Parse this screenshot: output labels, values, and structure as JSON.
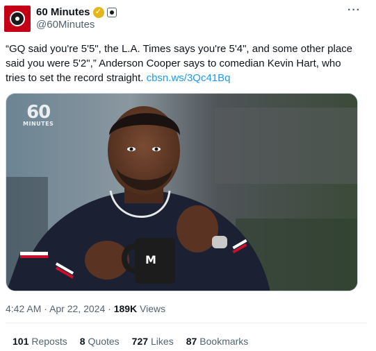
{
  "author": {
    "display_name": "60 Minutes",
    "handle": "@60Minutes",
    "verified_badge": "✓"
  },
  "tweet": {
    "text": "“GQ said you're 5'5\", the L.A. Times says you're 5'4\", and some other place said you were 5'2\",” Anderson Cooper says to comedian Kevin Hart, who tries to set the record straight.",
    "link": "cbsn.ws/3Qc41Bq"
  },
  "media": {
    "watermark_number": "60",
    "watermark_word": "MINUTES"
  },
  "meta": {
    "time": "4:42 AM",
    "separator": "·",
    "date": "Apr 22, 2024",
    "separator2": "·",
    "views_count": "189K",
    "views_label": "Views"
  },
  "stats": {
    "reposts_count": "101",
    "reposts_label": "Reposts",
    "quotes_count": "8",
    "quotes_label": "Quotes",
    "likes_count": "727",
    "likes_label": "Likes",
    "bookmarks_count": "87",
    "bookmarks_label": "Bookmarks"
  },
  "icons": {
    "avatar": "60-minutes-stopwatch-logo",
    "verified": "gold-verified-badge-icon",
    "affiliate": "affiliate-badge-icon",
    "more": "more-options-icon"
  },
  "colors": {
    "link": "#1d9bf0",
    "secondary_text": "#536471",
    "primary_text": "#0f1419",
    "verified_gold": "#e2b719",
    "brand_red": "#c40016"
  }
}
